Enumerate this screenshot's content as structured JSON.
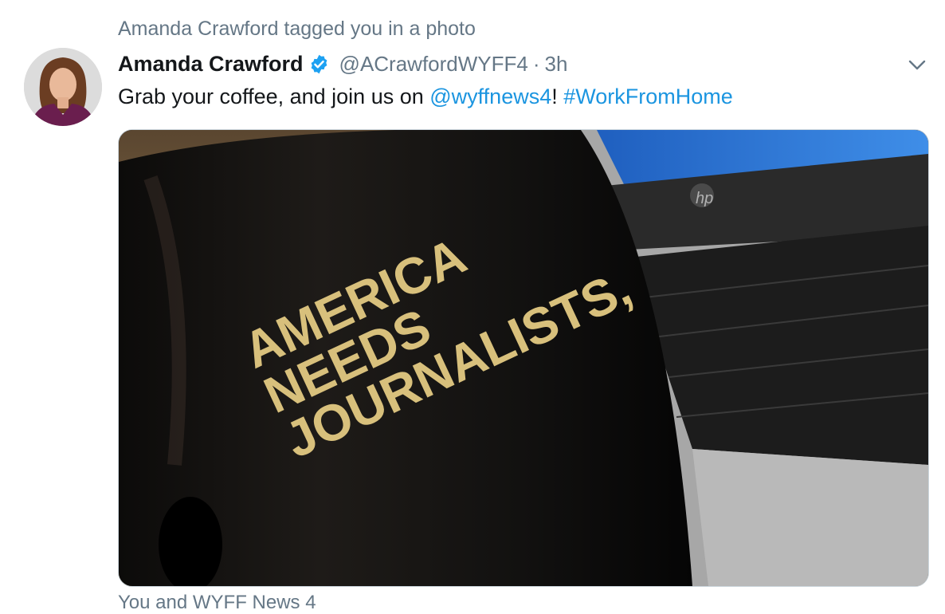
{
  "context": {
    "text": "Amanda Crawford tagged you in a photo"
  },
  "tweet": {
    "author_name": "Amanda Crawford",
    "handle": "@ACrawfordWYFF4",
    "separator": "·",
    "time": "3h",
    "text_before": "Grab your coffee, and join us on ",
    "mention": "@wyffnews4",
    "text_between": "! ",
    "hashtag": "#WorkFromHome"
  },
  "photo": {
    "mug_text": [
      "AMERICA",
      "NEEDS",
      "JOURNALISTS,"
    ],
    "laptop_logo": "hp"
  },
  "footer": {
    "tagged": "You and WYFF News 4"
  },
  "colors": {
    "link": "#1b95e0",
    "verified": "#1da1f2",
    "muted": "#657786"
  }
}
